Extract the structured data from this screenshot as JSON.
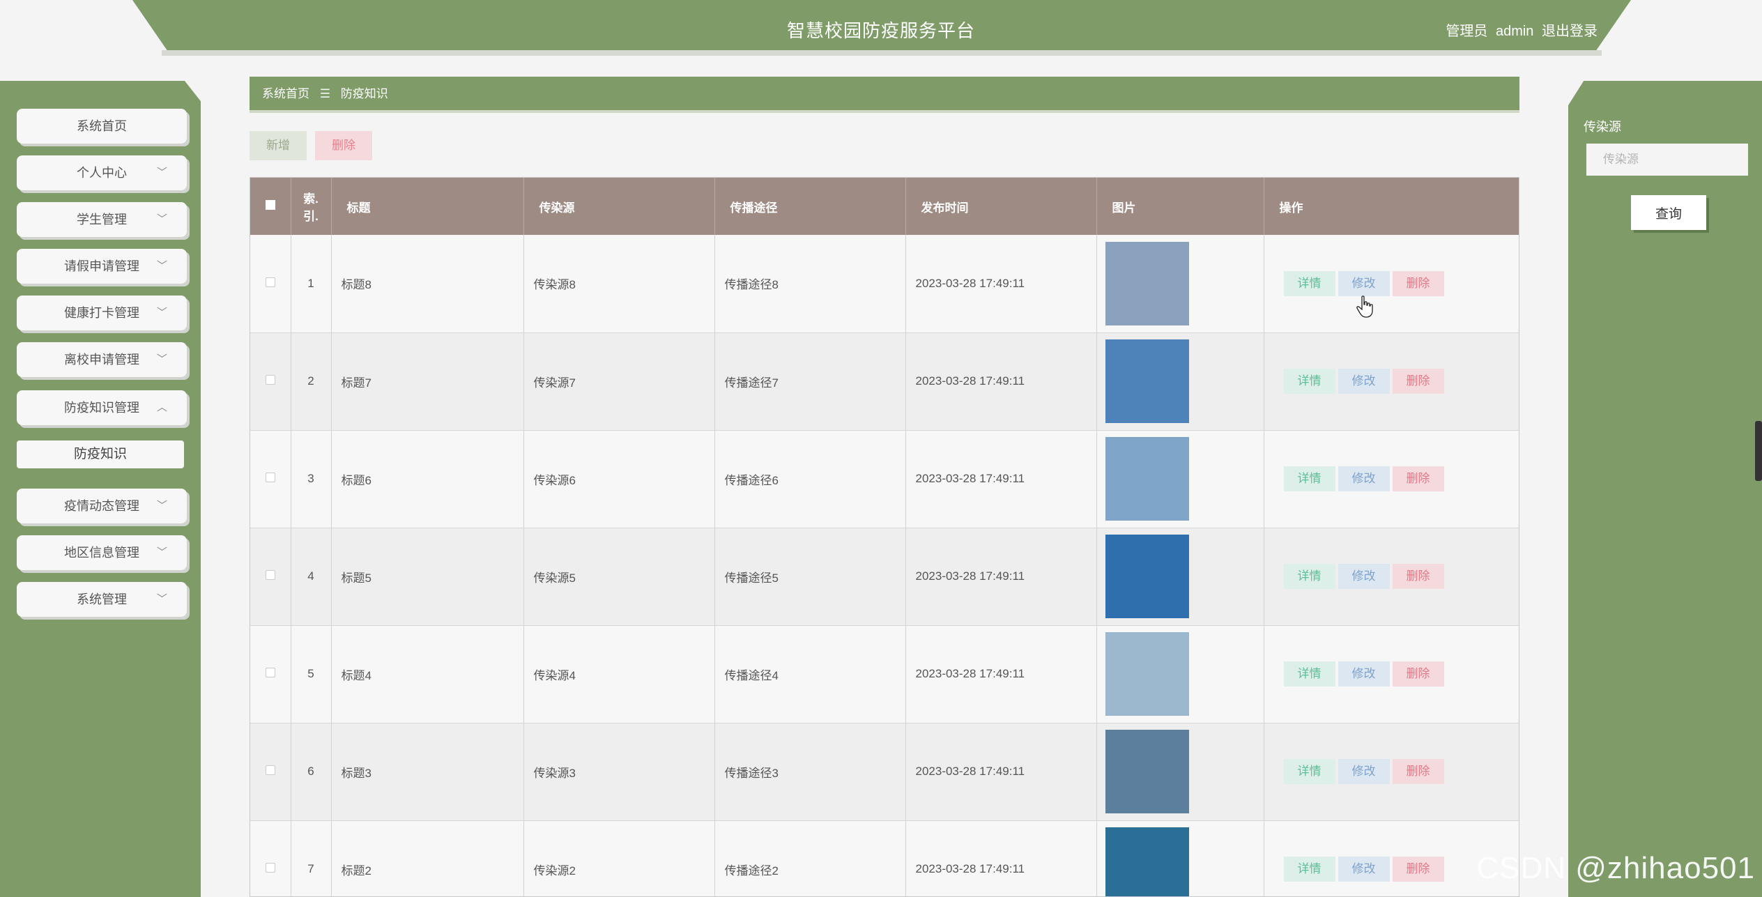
{
  "header": {
    "title": "智慧校园防疫服务平台",
    "role": "管理员",
    "username": "admin",
    "logout_label": "退出登录",
    "accent_color": "#7e9b68"
  },
  "sidebar": {
    "items": [
      {
        "label": "系统首页",
        "has_dropdown": false
      },
      {
        "label": "个人中心",
        "has_dropdown": true
      },
      {
        "label": "学生管理",
        "has_dropdown": true
      },
      {
        "label": "请假申请管理",
        "has_dropdown": true
      },
      {
        "label": "健康打卡管理",
        "has_dropdown": true
      },
      {
        "label": "离校申请管理",
        "has_dropdown": true
      },
      {
        "label": "防疫知识管理",
        "has_dropdown": true,
        "expanded": true
      },
      {
        "label": "疫情动态管理",
        "has_dropdown": true
      },
      {
        "label": "地区信息管理",
        "has_dropdown": true
      },
      {
        "label": "系统管理",
        "has_dropdown": true
      }
    ],
    "active_sub_item": "防疫知识"
  },
  "breadcrumb": {
    "home": "系统首页",
    "separator": "☰",
    "current": "防疫知识"
  },
  "toolbar": {
    "add_label": "新增",
    "delete_label": "删除"
  },
  "filter": {
    "label": "传染源",
    "placeholder": "传染源",
    "query_label": "查询"
  },
  "table": {
    "columns": [
      "",
      "索引",
      "标题",
      "传染源",
      "传播途径",
      "发布时间",
      "图片",
      "操作"
    ],
    "index_header_line1": "索.",
    "index_header_line2": "引.",
    "rows": [
      {
        "index": "1",
        "title": "标题8",
        "source": "传染源8",
        "route": "传播途径8",
        "time": "2023-03-28 17:49:11",
        "image_color": "#8aa2bd"
      },
      {
        "index": "2",
        "title": "标题7",
        "source": "传染源7",
        "route": "传播途径7",
        "time": "2023-03-28 17:49:11",
        "image_color": "#4d83b8"
      },
      {
        "index": "3",
        "title": "标题6",
        "source": "传染源6",
        "route": "传播途径6",
        "time": "2023-03-28 17:49:11",
        "image_color": "#7fa5c9"
      },
      {
        "index": "4",
        "title": "标题5",
        "source": "传染源5",
        "route": "传播途径5",
        "time": "2023-03-28 17:49:11",
        "image_color": "#2f6fae"
      },
      {
        "index": "5",
        "title": "标题4",
        "source": "传染源4",
        "route": "传播途径4",
        "time": "2023-03-28 17:49:11",
        "image_color": "#9cb8cf"
      },
      {
        "index": "6",
        "title": "标题3",
        "source": "传染源3",
        "route": "传播途径3",
        "time": "2023-03-28 17:49:11",
        "image_color": "#5c7f9e"
      },
      {
        "index": "7",
        "title": "标题2",
        "source": "传染源2",
        "route": "传播途径2",
        "time": "2023-03-28 17:49:11",
        "image_color": "#2b6f97"
      }
    ],
    "actions": {
      "detail": "详情",
      "edit": "修改",
      "delete": "删除"
    }
  },
  "watermark": "CSDN @zhihao501"
}
